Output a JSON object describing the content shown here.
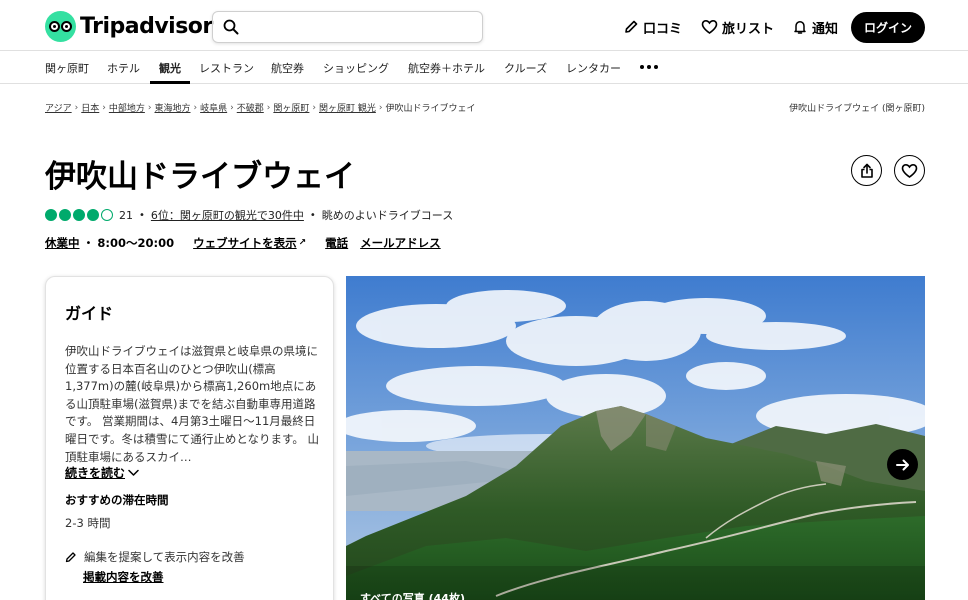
{
  "header": {
    "logo_text": "Tripadvisor",
    "search_placeholder": "",
    "review_label": "口コミ",
    "trips_label": "旅リスト",
    "alerts_label": "通知",
    "login_label": "ログイン"
  },
  "catnav": {
    "items": [
      "関ヶ原町",
      "ホテル",
      "観光",
      "レストラン",
      "航空券",
      "ショッピング",
      "航空券＋ホテル",
      "クルーズ",
      "レンタカー"
    ],
    "active": "観光"
  },
  "breadcrumb": {
    "items": [
      "アジア",
      "日本",
      "中部地方",
      "東海地方",
      "岐阜県",
      "不破郡",
      "関ヶ原町",
      "関ヶ原町 観光",
      "伊吹山ドライブウェイ"
    ],
    "right": "伊吹山ドライブウェイ (関ヶ原町)"
  },
  "title": "伊吹山ドライブウェイ",
  "rating": {
    "bubbles": 4,
    "max_bubbles": 5,
    "count": "21",
    "rank": "6位：関ヶ原町の観光で30件中",
    "category": "眺めのよいドライブコース"
  },
  "info": {
    "status": "休業中",
    "hours": "8:00～20:00",
    "website": "ウェブサイトを表示",
    "phone": "電話",
    "email": "メールアドレス"
  },
  "guide": {
    "title": "ガイド",
    "description": "伊吹山ドライブウェイは滋賀県と岐阜県の県境に位置する日本百名山のひとつ伊吹山(標高1,377m)の麓(岐阜県)から標高1,260m地点にある山頂駐車場(滋賀県)までを結ぶ自動車専用道路です。 営業期間は、4月第3土曜日～11月最終日曜日です。冬は積雪にて通行止めとなります。 山頂駐車場にあるスカイ…",
    "read_more": "続きを読む",
    "stay_label": "おすすめの滞在時間",
    "stay_value": "2-3 時間",
    "suggest_text": "編集を提案して表示内容を改善",
    "improve_link": "掲載内容を改善"
  },
  "photo": {
    "count_label": "すべての写真 (44枚)"
  },
  "colors": {
    "brand_green": "#34e0a1",
    "bubble_green": "#00aa6c"
  }
}
